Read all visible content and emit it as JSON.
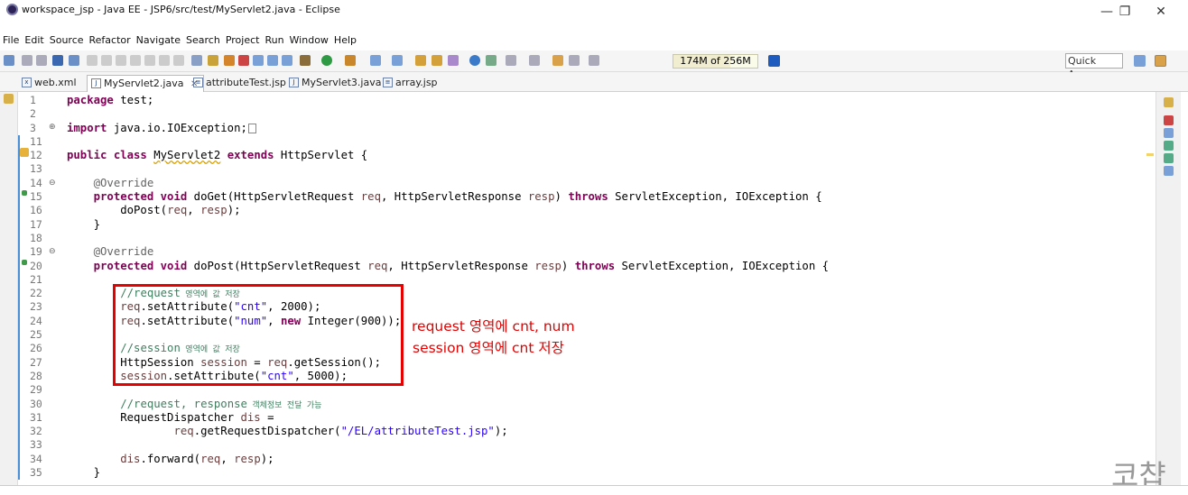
{
  "window": {
    "title": "workspace_jsp - Java EE - JSP6/src/test/MyServlet2.java - Eclipse",
    "minimize": "—",
    "restore": "❐",
    "close": "✕"
  },
  "menu": [
    "File",
    "Edit",
    "Source",
    "Refactor",
    "Navigate",
    "Search",
    "Project",
    "Run",
    "Window",
    "Help"
  ],
  "toolbar": {
    "heap_label": "174M of 256M",
    "heap_used_fraction": 0.68,
    "quick_access": "Quick Access"
  },
  "tabs": [
    {
      "label": "web.xml",
      "icon": "x",
      "active": false
    },
    {
      "label": "MyServlet2.java",
      "icon": "J",
      "active": true,
      "close": "✕"
    },
    {
      "label": "attributeTest.jsp",
      "icon": "≡",
      "active": false
    },
    {
      "label": "MyServlet3.java",
      "icon": "J",
      "active": false
    },
    {
      "label": "array.jsp",
      "icon": "≡",
      "active": false
    }
  ],
  "line_numbers": [
    "1",
    "2",
    "3",
    "11",
    "12",
    "13",
    "14",
    "15",
    "16",
    "17",
    "18",
    "19",
    "20",
    "21",
    "22",
    "23",
    "24",
    "25",
    "26",
    "27",
    "28",
    "29",
    "30",
    "31",
    "32",
    "33",
    "34",
    "35"
  ],
  "code": {
    "l1_kw": "package",
    "l1_rest": " test;",
    "l3_kw": "import",
    "l3_rest": " java.io.IOException;",
    "l12_kw1": "public class",
    "l12_name": "MyServlet2",
    "l12_kw2": "extends",
    "l12_rest": " HttpServlet {",
    "l14_ann": "@Override",
    "l15_kw": "protected void",
    "l15_a": " doGet(HttpServletRequest ",
    "l15_p1": "req",
    "l15_b": ", HttpServletResponse ",
    "l15_p2": "resp",
    "l15_c": ") ",
    "l15_kw2": "throws",
    "l15_d": " ServletException, IOException {",
    "l16_a": "        doPost(",
    "l16_p1": "req",
    "l16_b": ", ",
    "l16_p2": "resp",
    "l16_c": ");",
    "l17": "    }",
    "l19_ann": "@Override",
    "l20_kw": "protected void",
    "l20_a": " doPost(HttpServletRequest ",
    "l20_p1": "req",
    "l20_b": ", HttpServletResponse ",
    "l20_p2": "resp",
    "l20_c": ") ",
    "l20_kw2": "throws",
    "l20_d": " ServletException, IOException {",
    "l22_cmt": "//request",
    "l22_ko": " 영역에 값 저장",
    "l23_a": "req",
    "l23_b": ".setAttribute(",
    "l23_str": "\"cnt\"",
    "l23_c": ", 2000);",
    "l24_a": "req",
    "l24_b": ".setAttribute(",
    "l24_str": "\"num\"",
    "l24_c": ", ",
    "l24_kw": "new",
    "l24_d": " Integer(900));",
    "l26_cmt": "//session",
    "l26_ko": " 영역에 값 저장",
    "l27_a": "HttpSession ",
    "l27_v": "session",
    "l27_b": " = ",
    "l27_p": "req",
    "l27_c": ".getSession();",
    "l28_v": "session",
    "l28_b": ".setAttribute(",
    "l28_str": "\"cnt\"",
    "l28_c": ", 5000);",
    "l30_cmt": "//request, response",
    "l30_ko": " 객체정보 전달 가능",
    "l31_a": "RequestDispatcher ",
    "l31_v": "dis",
    "l31_b": " =",
    "l32_p": "req",
    "l32_a": ".getRequestDispatcher(",
    "l32_str": "\"/EL/attributeTest.jsp\"",
    "l32_b": ");",
    "l34_v": "dis",
    "l34_a": ".forward(",
    "l34_p1": "req",
    "l34_b": ", ",
    "l34_p2": "resp",
    "l34_c": ");",
    "l35": "    }"
  },
  "annotation": {
    "line1": "request 영역에 cnt, num",
    "line2": "session 영역에 cnt 저장"
  },
  "watermark": "코챱",
  "colors": {
    "keyword": "#7f0055",
    "string": "#2a00ff",
    "comment": "#3f7f5f",
    "annotation_red": "#e60000"
  }
}
